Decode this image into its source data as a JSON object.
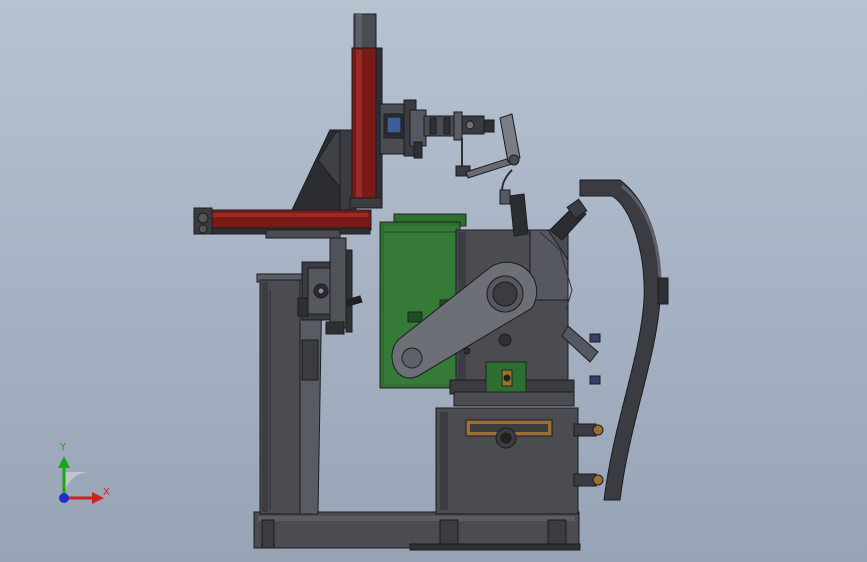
{
  "viewport": {
    "background_top": "#b7c2d1",
    "background_bottom": "#97a4b6"
  },
  "triad": {
    "x_label": "X",
    "y_label": "Y",
    "x_color": "#d42020",
    "y_color": "#1aa51a",
    "z_color": "#1f2fc4"
  },
  "colors": {
    "steel": "#4a4c52",
    "steel_dark": "#2e3034",
    "steel_light": "#6c6f76",
    "rail_red": "#7a1a16",
    "guard_green": "#2f6e31",
    "brass": "#9a7030",
    "window_blue": "#3d5d99"
  }
}
